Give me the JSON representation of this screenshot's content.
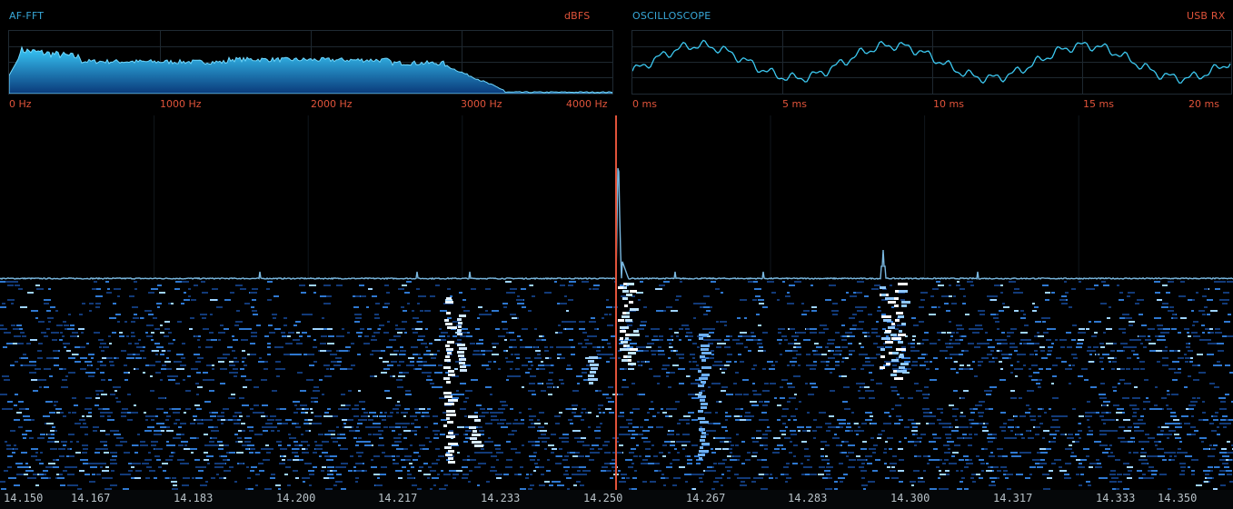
{
  "af_fft": {
    "title": "AF-FFT",
    "unit_label": "dBFS",
    "ticks": [
      "0 Hz",
      "1000 Hz",
      "2000 Hz",
      "3000 Hz",
      "4000 Hz"
    ]
  },
  "scope": {
    "title": "OSCILLOSCOPE",
    "mode_label": "USB RX",
    "ticks": [
      "0 ms",
      "5 ms",
      "10 ms",
      "15 ms",
      "20 ms"
    ]
  },
  "spectrum": {
    "tuned_frequency": "14.250",
    "freq_ticks": [
      "14.150",
      "14.167",
      "14.183",
      "14.200",
      "14.217",
      "14.233",
      "14.250",
      "14.267",
      "14.283",
      "14.300",
      "14.317",
      "14.333",
      "14.350"
    ]
  },
  "colors": {
    "accent_blue": "#38a8d8",
    "accent_red": "#e0533a",
    "trace": "#6fb8e8",
    "tuning_line": "#e0533a"
  }
}
